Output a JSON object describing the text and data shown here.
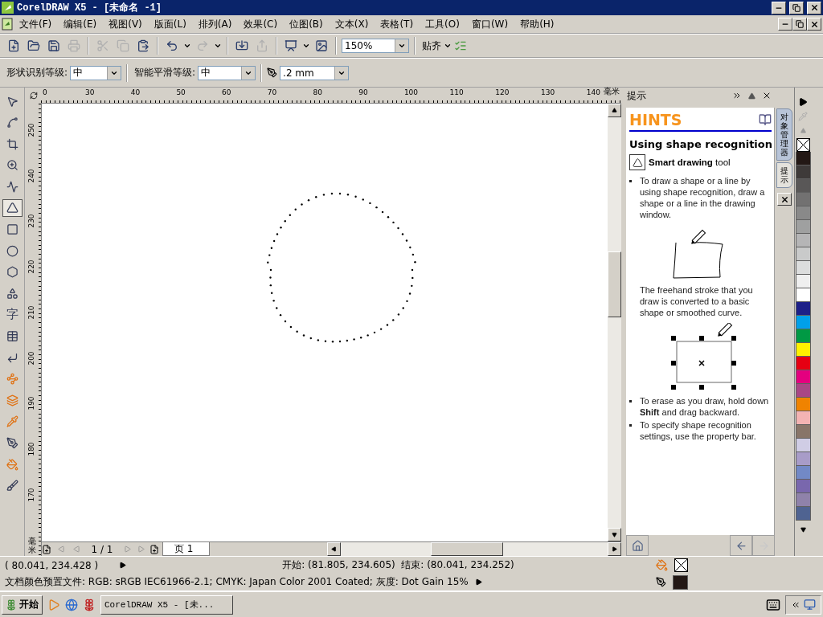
{
  "window": {
    "title": "CorelDRAW X5 - [未命名 -1]"
  },
  "menu": [
    "文件(F)",
    "编辑(E)",
    "视图(V)",
    "版面(L)",
    "排列(A)",
    "效果(C)",
    "位图(B)",
    "文本(X)",
    "表格(T)",
    "工具(O)",
    "窗口(W)",
    "帮助(H)"
  ],
  "toolbar": {
    "buttons": [
      {
        "kind": "new",
        "disabled": false
      },
      {
        "kind": "open",
        "disabled": false
      },
      {
        "kind": "save",
        "disabled": false
      },
      {
        "kind": "print",
        "disabled": true
      },
      {
        "kind": "cut",
        "disabled": true
      },
      {
        "kind": "copy",
        "disabled": true
      },
      {
        "kind": "paste",
        "disabled": false
      },
      {
        "kind": "undo",
        "disabled": false
      },
      {
        "kind": "redo",
        "disabled": true
      },
      {
        "kind": "import",
        "disabled": false
      },
      {
        "kind": "export",
        "disabled": true
      },
      {
        "kind": "launcher",
        "disabled": false
      },
      {
        "kind": "welcome",
        "disabled": false
      }
    ],
    "zoom": "150%",
    "snap": "贴齐"
  },
  "property_bar": {
    "shape_level": {
      "label": "形状识别等级:",
      "value": "中"
    },
    "smooth_level": {
      "label": "智能平滑等级:",
      "value": "中"
    },
    "outline_width": ".2 mm"
  },
  "toolbox": [
    {
      "kind": "pick",
      "selected": false
    },
    {
      "kind": "shape",
      "selected": false
    },
    {
      "kind": "crop",
      "selected": false
    },
    {
      "kind": "zoom",
      "selected": false
    },
    {
      "kind": "freehand",
      "selected": false
    },
    {
      "kind": "smart",
      "selected": true
    },
    {
      "kind": "rectangle",
      "selected": false
    },
    {
      "kind": "ellipse",
      "selected": false
    },
    {
      "kind": "polygon",
      "selected": false
    },
    {
      "kind": "basic-shapes",
      "selected": false
    },
    {
      "kind": "text",
      "glyph": "字",
      "selected": false
    },
    {
      "kind": "table",
      "selected": false
    },
    {
      "kind": "dimension",
      "selected": false
    },
    {
      "kind": "connector",
      "selected": false
    },
    {
      "kind": "blend",
      "selected": false
    },
    {
      "kind": "eyedropper",
      "selected": false
    },
    {
      "kind": "outline",
      "selected": false
    },
    {
      "kind": "fill",
      "selected": false
    },
    {
      "kind": "interactive-fill",
      "selected": false
    }
  ],
  "rulers": {
    "horizontal": [
      "0",
      "30",
      "40",
      "50",
      "60",
      "70",
      "80",
      "90",
      "100",
      "110",
      "120",
      "130",
      "140"
    ],
    "horizontal_unit": "毫米",
    "vertical": [
      "250",
      "240",
      "230",
      "220",
      "210",
      "200",
      "190",
      "180",
      "170"
    ],
    "vertical_unit": "毫米"
  },
  "page_nav": {
    "position": "1 / 1",
    "tabs": [
      {
        "label": "页 1",
        "selected": true
      }
    ]
  },
  "docker": {
    "title": "提示",
    "heading": "HINTS",
    "subtitle": "Using shape recognition",
    "tool": "**Smart drawing** tool",
    "items": [
      {
        "kind": "bullet",
        "text": "To draw a shape or a line by using shape recognition, draw a shape or a line in the drawing window."
      },
      {
        "kind": "freehand-figure"
      },
      {
        "kind": "para",
        "text": "The freehand stroke that you draw is converted to a basic shape or smoothed curve."
      },
      {
        "kind": "recognized-figure"
      },
      {
        "kind": "bullet",
        "text": "To erase as you draw, hold down **Shift** and drag backward."
      },
      {
        "kind": "bullet",
        "text": "To specify shape recognition settings, use the property bar."
      }
    ]
  },
  "docker_tabs": [
    {
      "label": "对象管理器",
      "selected": false
    },
    {
      "label": "提示",
      "selected": true
    }
  ],
  "palette": [
    {
      "kind": "none"
    },
    {
      "kind": "color",
      "color": "#231815"
    },
    {
      "kind": "color",
      "color": "#3e3a39"
    },
    {
      "kind": "color",
      "color": "#595757"
    },
    {
      "kind": "color",
      "color": "#727171"
    },
    {
      "kind": "color",
      "color": "#898989"
    },
    {
      "kind": "color",
      "color": "#9fa0a0"
    },
    {
      "kind": "color",
      "color": "#b5b5b6"
    },
    {
      "kind": "color",
      "color": "#c9caca"
    },
    {
      "kind": "color",
      "color": "#dcdddd"
    },
    {
      "kind": "color",
      "color": "#efefef"
    },
    {
      "kind": "color",
      "color": "#ffffff"
    },
    {
      "kind": "color",
      "color": "#1d2088"
    },
    {
      "kind": "color",
      "color": "#00a0e9"
    },
    {
      "kind": "color",
      "color": "#009944"
    },
    {
      "kind": "color",
      "color": "#fff100"
    },
    {
      "kind": "color",
      "color": "#e60012"
    },
    {
      "kind": "color",
      "color": "#e4007f"
    },
    {
      "kind": "color",
      "color": "#a94785"
    },
    {
      "kind": "color",
      "color": "#f08300"
    },
    {
      "kind": "color",
      "color": "#f3b3b3"
    },
    {
      "kind": "color",
      "color": "#887569"
    },
    {
      "kind": "color",
      "color": "#d0cde5"
    },
    {
      "kind": "color",
      "color": "#a89cc8"
    },
    {
      "kind": "color",
      "color": "#7289c6"
    },
    {
      "kind": "color",
      "color": "#7967ad"
    },
    {
      "kind": "color",
      "color": "#8f82aa"
    },
    {
      "kind": "color",
      "color": "#4f6391"
    }
  ],
  "status": {
    "cursor": "( 80.041, 234.428 )",
    "start_end": "开始: (81.805, 234.605)  结束: (80.041, 234.252)",
    "color_profile": "文档颜色预置文件: RGB: sRGB IEC61966-2.1; CMYK: Japan Color 2001 Coated; 灰度: Dot Gain 15%"
  },
  "taskbar": {
    "start": "开始",
    "tasks": [
      {
        "label": "CorelDRAW X5 - [未...",
        "selected": false
      }
    ]
  }
}
